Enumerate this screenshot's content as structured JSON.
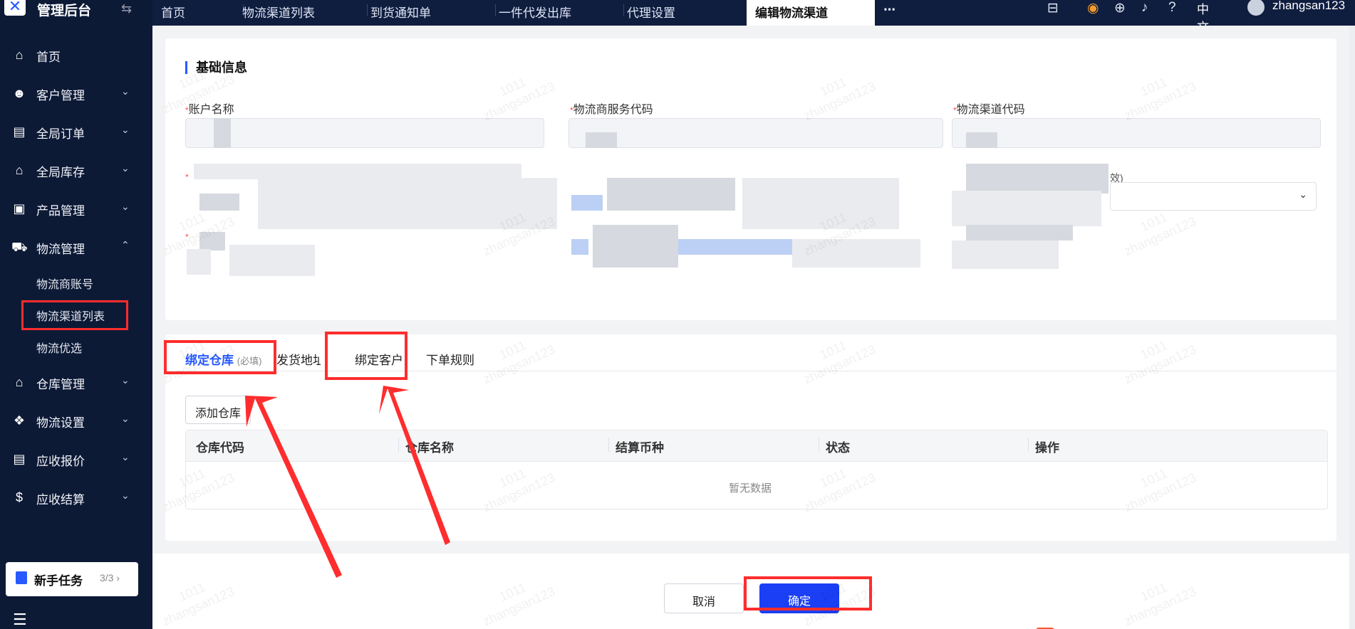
{
  "app": {
    "title": "管理后台",
    "logo_icon": "x-logo-icon"
  },
  "topbar": {
    "tabs": [
      {
        "label": "首页"
      },
      {
        "label": "物流渠道列表"
      },
      {
        "label": "到货通知单"
      },
      {
        "label": "一件代发出库"
      },
      {
        "label": "代理设置"
      },
      {
        "label": "编辑物流渠道"
      }
    ],
    "more": "⋯",
    "language": "中文",
    "username": "zhangsan123"
  },
  "sidebar": {
    "items": [
      {
        "label": "首页",
        "icon": "home-icon"
      },
      {
        "label": "客户管理",
        "icon": "users-icon"
      },
      {
        "label": "全局订单",
        "icon": "clipboard-icon"
      },
      {
        "label": "全局库存",
        "icon": "warehouse-icon"
      },
      {
        "label": "产品管理",
        "icon": "bag-icon"
      },
      {
        "label": "物流管理",
        "icon": "truck-icon"
      },
      {
        "label": "仓库管理",
        "icon": "warehouse-icon"
      },
      {
        "label": "物流设置",
        "icon": "box-gear-icon"
      },
      {
        "label": "应收报价",
        "icon": "document-icon"
      },
      {
        "label": "应收结算",
        "icon": "dollar-icon"
      }
    ],
    "sub_items": [
      {
        "label": "物流商账号"
      },
      {
        "label": "物流渠道列表"
      },
      {
        "label": "物流优选"
      }
    ],
    "task": {
      "label": "新手任务",
      "count": "3/3"
    }
  },
  "form": {
    "section_title": "基础信息",
    "fields": {
      "account_name": "账户名称",
      "provider_service_code": "物流商服务代码",
      "channel_code": "物流渠道代码"
    },
    "required_mark": "*",
    "partial_hint": "效)"
  },
  "subtabs": {
    "bind_warehouse": "绑定仓库",
    "bind_warehouse_tag": "(必填)",
    "ship_address": "发货地址",
    "bind_customer": "绑定客户",
    "order_rules": "下单规则"
  },
  "warehouse": {
    "add_button": "添加仓库",
    "columns": [
      "仓库代码",
      "仓库名称",
      "结算币种",
      "状态",
      "操作"
    ],
    "empty_text": "暂无数据"
  },
  "footer": {
    "cancel": "取消",
    "confirm": "确定"
  },
  "watermark": {
    "line1": "1011",
    "line2": "zhangsan123"
  },
  "colors": {
    "primary": "#1a3ff5",
    "sidebar": "#0d1a36",
    "highlight": "#ff2d2d"
  }
}
